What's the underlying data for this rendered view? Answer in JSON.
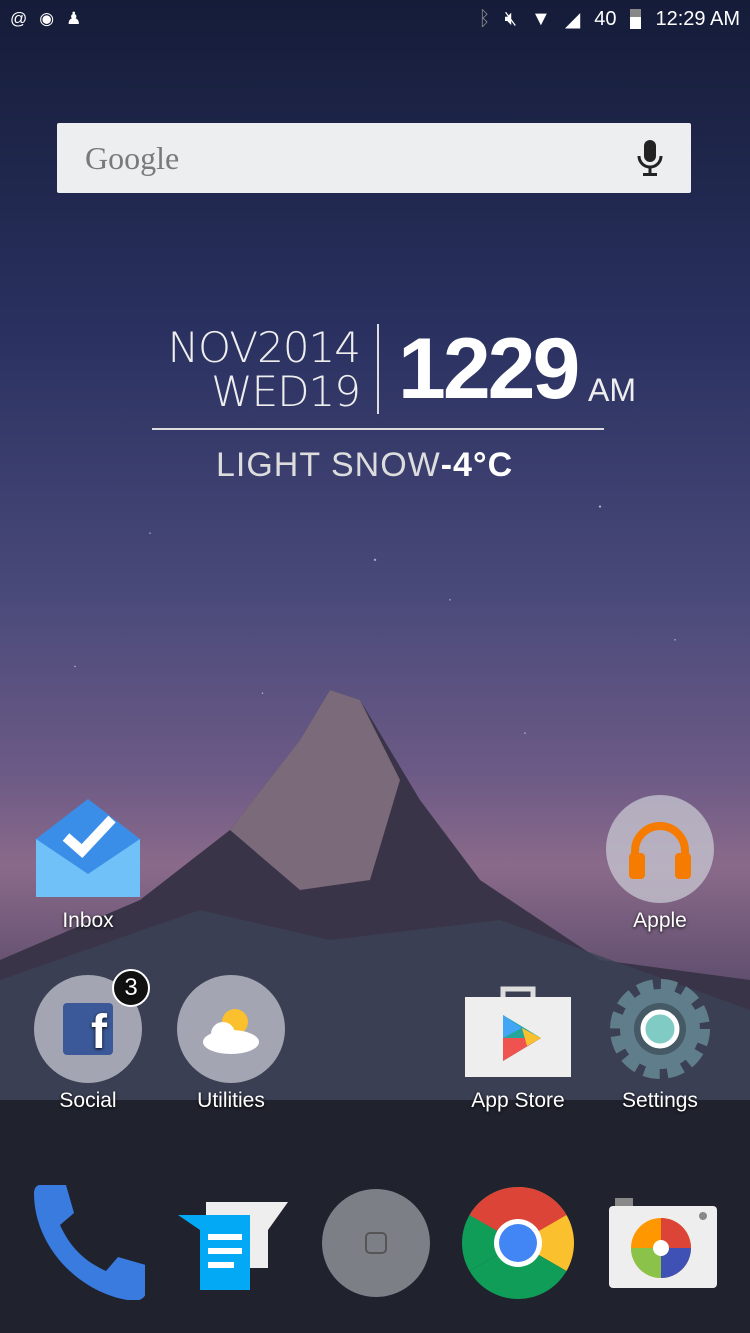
{
  "status_bar": {
    "notifications": [
      "@",
      "messenger-icon",
      "snapchat-icon"
    ],
    "battery_level": "40",
    "time": "12:29 AM"
  },
  "search": {
    "logo": "Google"
  },
  "widget": {
    "month_year": "NOV2014",
    "day": "WED19",
    "time": "1229",
    "ampm": "AM",
    "condition": "LIGHT SNOW",
    "temperature": "-4°C"
  },
  "apps": [
    {
      "label": "Inbox"
    },
    {
      "label": "Apple"
    },
    {
      "label": "Social",
      "badge": "3"
    },
    {
      "label": "Utilities"
    },
    {
      "label": "App Store"
    },
    {
      "label": "Settings"
    }
  ],
  "dock": [
    "phone",
    "messages",
    "home",
    "chrome",
    "camera"
  ]
}
